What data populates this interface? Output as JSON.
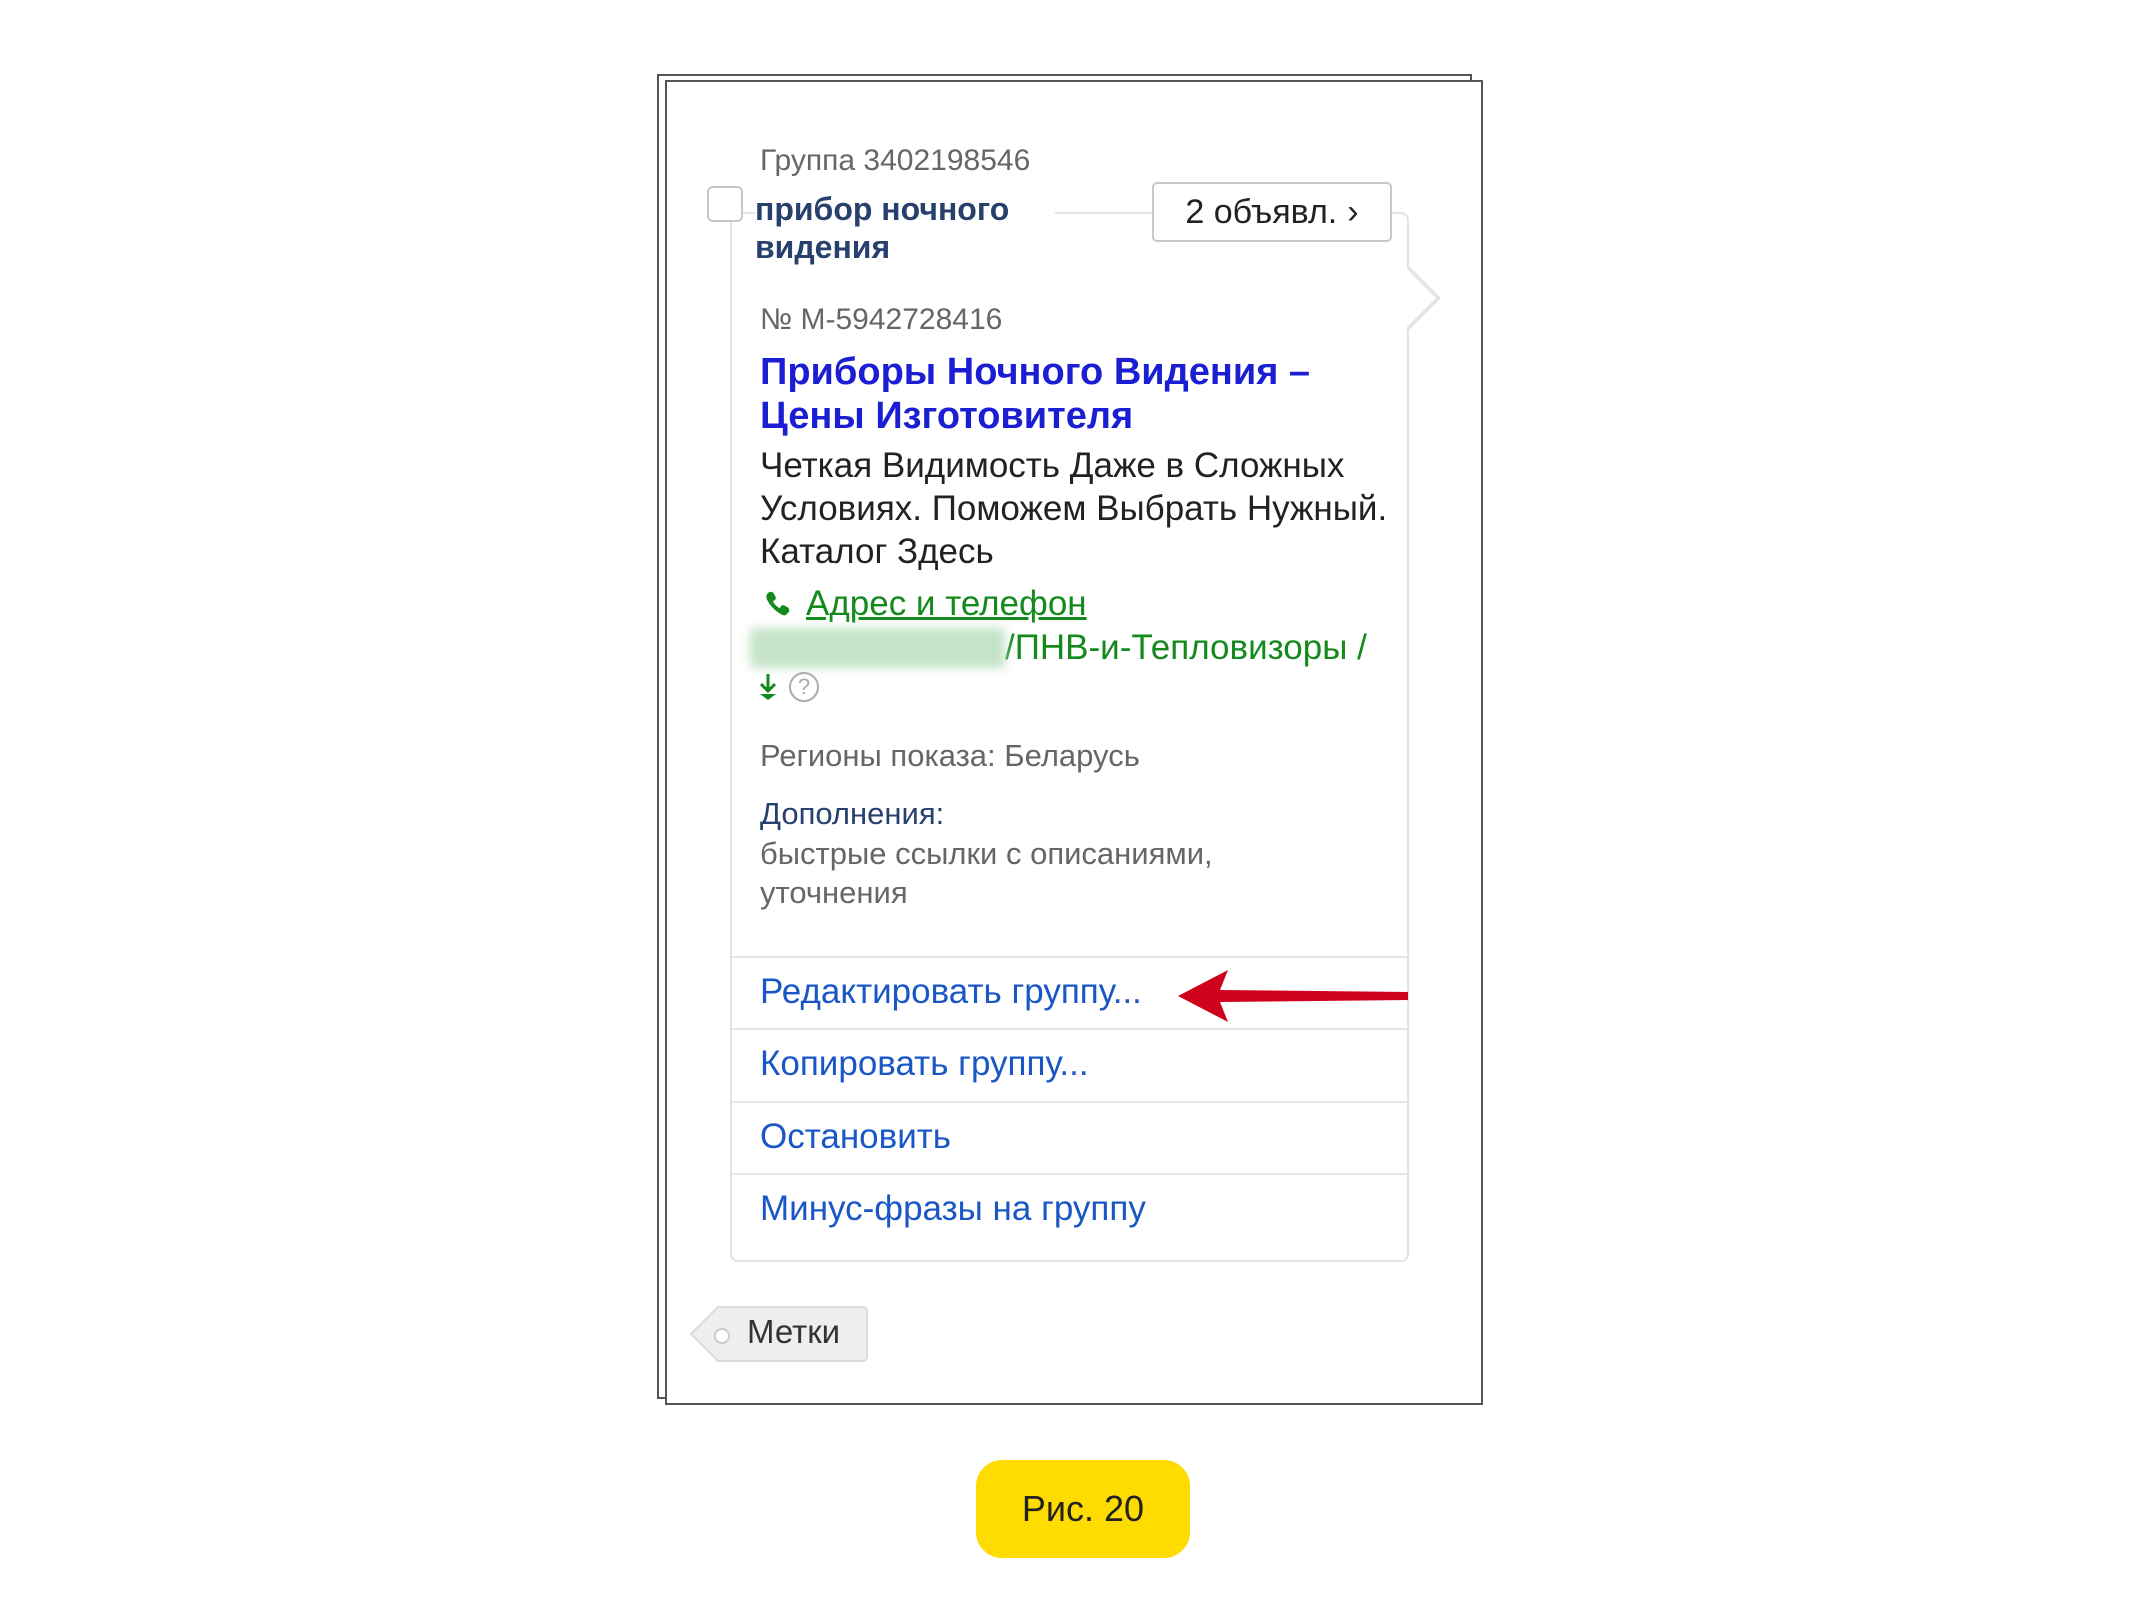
{
  "group": {
    "number_label": "Группа 3402198546",
    "name": "прибор ночного видения",
    "ads_button": "2 объявл.",
    "ads_chevron": "›"
  },
  "ad": {
    "number": "№ M-5942728416",
    "title": "Приборы Ночного Видения – Цены Изготовителя",
    "text": "Четкая Видимость Даже в Сложных Условиях. Поможем Выбрать Нужный. Каталог Здесь",
    "contact_link": "Адрес и телефон",
    "url_path": "/ПНВ-и-Тепловизоры /",
    "help_glyph": "?",
    "regions": "Регионы показа: Беларусь",
    "extras_label": "Дополнения:",
    "extras_value": "быстрые ссылки с описаниями, уточнения"
  },
  "menu": {
    "edit": "Редактировать группу...",
    "copy": "Копировать группу...",
    "stop": "Остановить",
    "negative": "Минус-фразы на группу"
  },
  "tag_label": "Метки",
  "caption": "Рис. 20",
  "colors": {
    "link_blue": "#1a57c6",
    "title_blue": "#1b1ed2",
    "url_green": "#138a1b",
    "arrow_red": "#d0021b",
    "caption_yellow": "#ffdc00"
  }
}
